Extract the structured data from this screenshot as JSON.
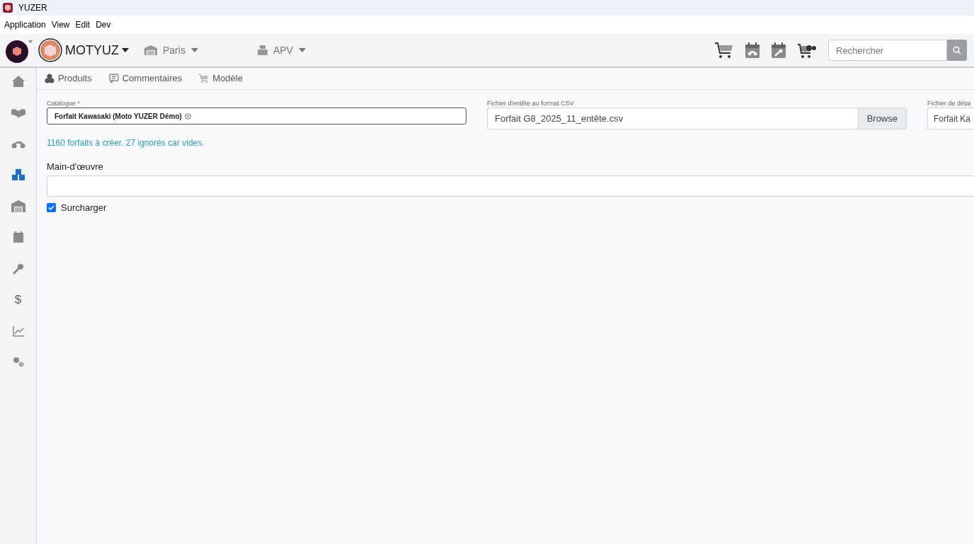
{
  "window": {
    "title": "YUZER"
  },
  "menu": [
    "Application",
    "View",
    "Edit",
    "Dev"
  ],
  "topbar": {
    "company": "MOTYUZ",
    "site": "Paris",
    "module": "APV",
    "search": {
      "placeholder": "Rechercher"
    }
  },
  "sidebar": {
    "items": [
      {
        "selected": false
      },
      {
        "selected": false
      },
      {
        "selected": false
      },
      {
        "selected": true
      },
      {
        "selected": false
      },
      {
        "selected": false
      },
      {
        "selected": false
      },
      {
        "selected": false,
        "glyph": "$"
      },
      {
        "selected": false
      },
      {
        "selected": false
      }
    ]
  },
  "tabs": [
    {
      "label": "Produits",
      "selected": false
    },
    {
      "label": "Commentaires",
      "selected": false
    },
    {
      "label": "Modèle",
      "selected": false
    }
  ],
  "form": {
    "catalogue": {
      "label": "Catalogue *",
      "value": "Forfait Kawasaki (Moto YUZER Démo)"
    },
    "header_file": {
      "label": "Fichier d'entête au format CSV",
      "value": "Forfait G8_2025_11_entête.csv",
      "button": "Browse"
    },
    "detail_file": {
      "label": "Fichier de détai",
      "value": "Forfait Ka"
    },
    "message": "1160 forfaits à créer. 27 ignorés car vides.",
    "labour": {
      "label": "Main-d'œuvre"
    },
    "override": {
      "label": "Surcharger",
      "checked": true
    }
  }
}
